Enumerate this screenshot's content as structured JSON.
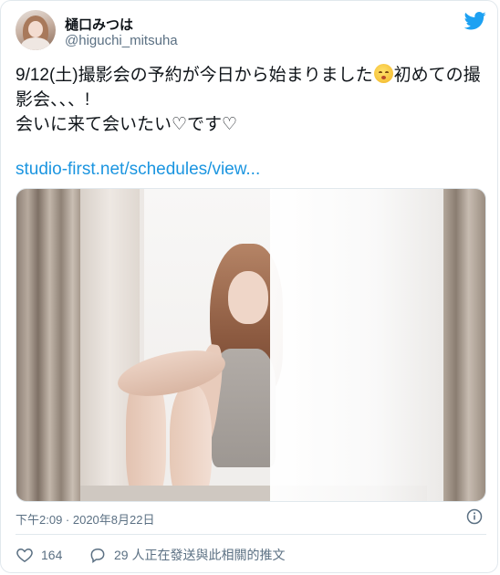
{
  "author": {
    "display_name": "樋口みつは",
    "handle": "@higuchi_mitsuha"
  },
  "tweet": {
    "text_before_emoji": "9/12(土)撮影会の予約が今日から始まりました",
    "text_after_emoji": "初めての撮影会、、、!\n会いに来て会いたい♡です♡",
    "link": "studio-first.net/schedules/view..."
  },
  "meta": {
    "timestamp": "下午2:09 · 2020年8月22日"
  },
  "actions": {
    "likes": "164",
    "replies": "29 人正在發送與此相關的推文"
  },
  "colors": {
    "accent": "#1b95e0",
    "muted": "#5b7083",
    "border": "#e1e8ed"
  },
  "icons": {
    "brand": "twitter-bird-icon",
    "emoji": "kissing-cat-emoji-icon",
    "info": "info-icon",
    "like": "heart-icon",
    "reply": "speech-bubble-icon"
  }
}
